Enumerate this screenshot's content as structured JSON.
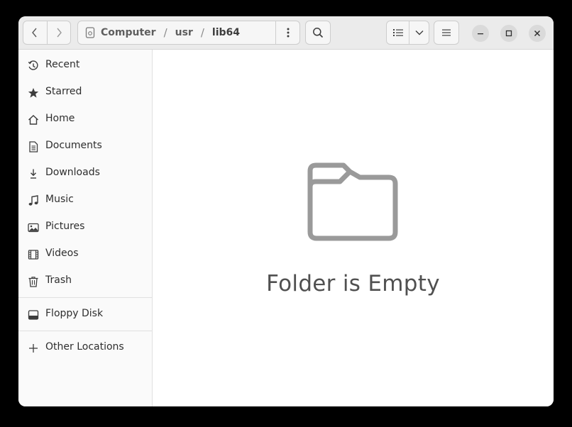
{
  "pathbar": {
    "crumbs": [
      "Computer",
      "usr",
      "lib64"
    ]
  },
  "sidebar": {
    "items": [
      {
        "label": "Recent",
        "icon": "recent-icon"
      },
      {
        "label": "Starred",
        "icon": "star-icon"
      },
      {
        "label": "Home",
        "icon": "home-icon"
      },
      {
        "label": "Documents",
        "icon": "document-icon"
      },
      {
        "label": "Downloads",
        "icon": "download-icon"
      },
      {
        "label": "Music",
        "icon": "music-icon"
      },
      {
        "label": "Pictures",
        "icon": "picture-icon"
      },
      {
        "label": "Videos",
        "icon": "video-icon"
      },
      {
        "label": "Trash",
        "icon": "trash-icon"
      }
    ],
    "devices": [
      {
        "label": "Floppy Disk",
        "icon": "drive-icon"
      }
    ],
    "other": {
      "label": "Other Locations",
      "icon": "plus-icon"
    }
  },
  "content": {
    "empty_message": "Folder is Empty"
  },
  "colors": {
    "background": "#000000",
    "headerbar": "#ebebeb",
    "sidebar": "#fafafa",
    "folder_icon": "#9a9a9a"
  }
}
